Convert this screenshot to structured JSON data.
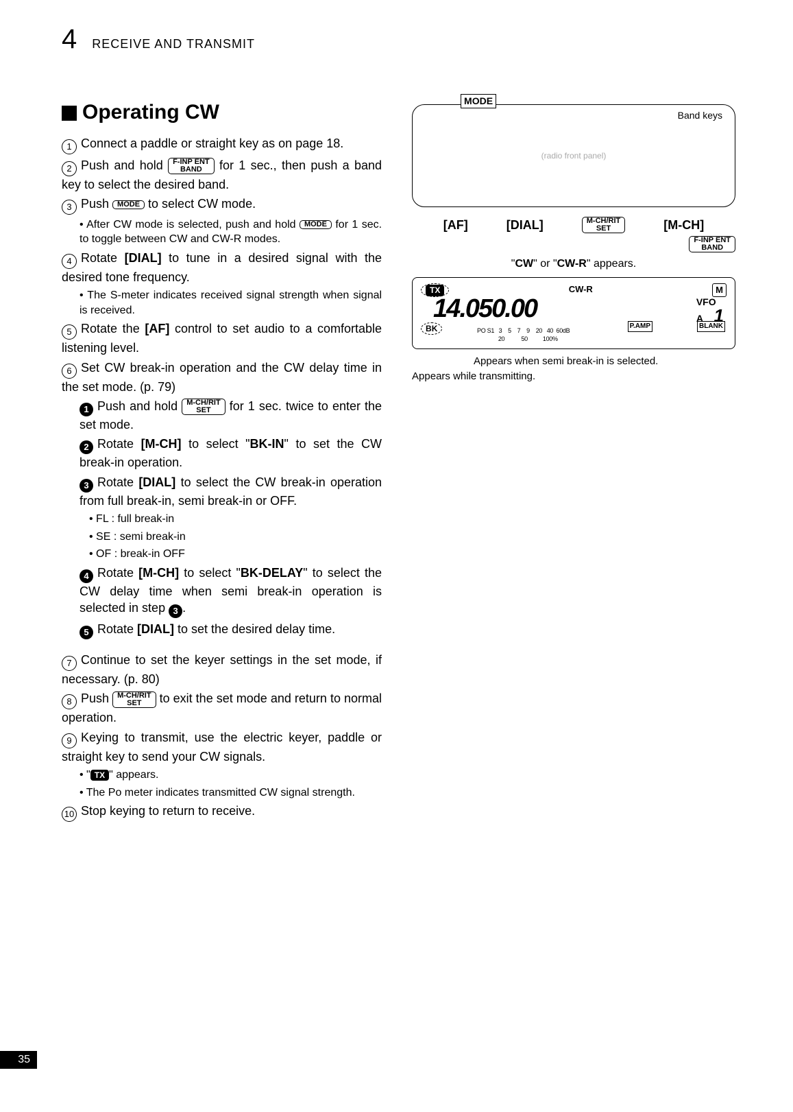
{
  "page_number_top": "4",
  "header": "RECEIVE AND TRANSMIT",
  "title": "Operating CW",
  "steps": {
    "s1": "Connect a paddle or straight key as on page 18.",
    "s2a": "Push and hold ",
    "s2b": " for 1 sec., then push a band key to select the desired band.",
    "s3a": "Push ",
    "s3b": " to select CW mode.",
    "s3sub_a": "• After CW mode is selected, push and hold ",
    "s3sub_b": " for 1 sec. to toggle between CW and CW-R modes.",
    "s4": "Rotate [DIAL] to tune in a desired signal with the desired tone frequency.",
    "s4sub": "• The S-meter indicates received signal strength when signal is received.",
    "s5": "Rotate the [AF] control to set audio to a comfortable listening level.",
    "s6": "Set CW break-in operation and the CW delay time in the set mode. (p. 79)",
    "b1a": "Push and hold ",
    "b1b": " for 1 sec. twice to enter the set mode.",
    "b2a": "Rotate [M-CH] to select \"",
    "b2b": "\" to set the CW break-in operation.",
    "b2key": "BK-IN",
    "b3": "Rotate [DIAL] to select the CW break-in operation from full break-in, semi break-in or OFF.",
    "b3_fl": "• FL  : full break-in",
    "b3_se": "• SE : semi break-in",
    "b3_of": "• OF : break-in OFF",
    "b4a": "Rotate [M-CH] to select \"",
    "b4b": "\" to select the CW delay time when semi break-in operation is selected in step ",
    "b4key": "BK-DELAY",
    "b5": "Rotate [DIAL] to set the desired delay time.",
    "s7": "Continue to set the keyer settings in the set mode, if necessary. (p. 80)",
    "s8a": "Push ",
    "s8b": " to exit the set mode and return to normal operation.",
    "s9": "Keying to transmit, use the electric keyer, paddle or straight key to send your CW signals.",
    "s9sub_a": "• \"",
    "s9sub_b": "\" appears.",
    "s9sub2": "• The Po meter indicates transmitted CW signal strength.",
    "s10": "Stop keying to return to receive."
  },
  "markers": {
    "c1": "1",
    "c2": "2",
    "c3": "3",
    "c4": "4",
    "c5": "5",
    "c6": "6",
    "c7": "7",
    "c8": "8",
    "c9": "9",
    "c10": "10",
    "s1": "1",
    "s2": "2",
    "s3": "3",
    "s4": "4",
    "s5": "5"
  },
  "keys": {
    "finp_top": "F-INP ENT",
    "finp_bot": "BAND",
    "mode": "MODE",
    "mch_top": "M-CH/RIT",
    "mch_bot": "SET"
  },
  "tx_label": "TX",
  "right": {
    "panel_mode": "MODE",
    "panel_band": "Band keys",
    "lbl_af": "[AF]",
    "lbl_dial": "[DIAL]",
    "lbl_mch_btn_top": "M-CH/RIT",
    "lbl_mch_btn_bot": "SET",
    "lbl_mch": "[M-CH]",
    "finp_top": "F-INP ENT",
    "finp_bot": "BAND",
    "caption_cw": "\"CW\" or \"CW-R\" appears.",
    "lcd": {
      "tx": "TX",
      "cwr": "CW-R",
      "m": "M",
      "freq": "14.050.00",
      "vfo1": "VFO",
      "vfo2": "A",
      "one": "1",
      "pamp": "P.AMP",
      "blank": "BLANK",
      "bk": "BK",
      "meter": "PO S1   3    5    7    9    20   40  60dB\n              20           50          100%"
    },
    "note1": "Appears when semi break-in is selected.",
    "note2": "Appears while transmitting."
  },
  "page_number_bottom": "35"
}
